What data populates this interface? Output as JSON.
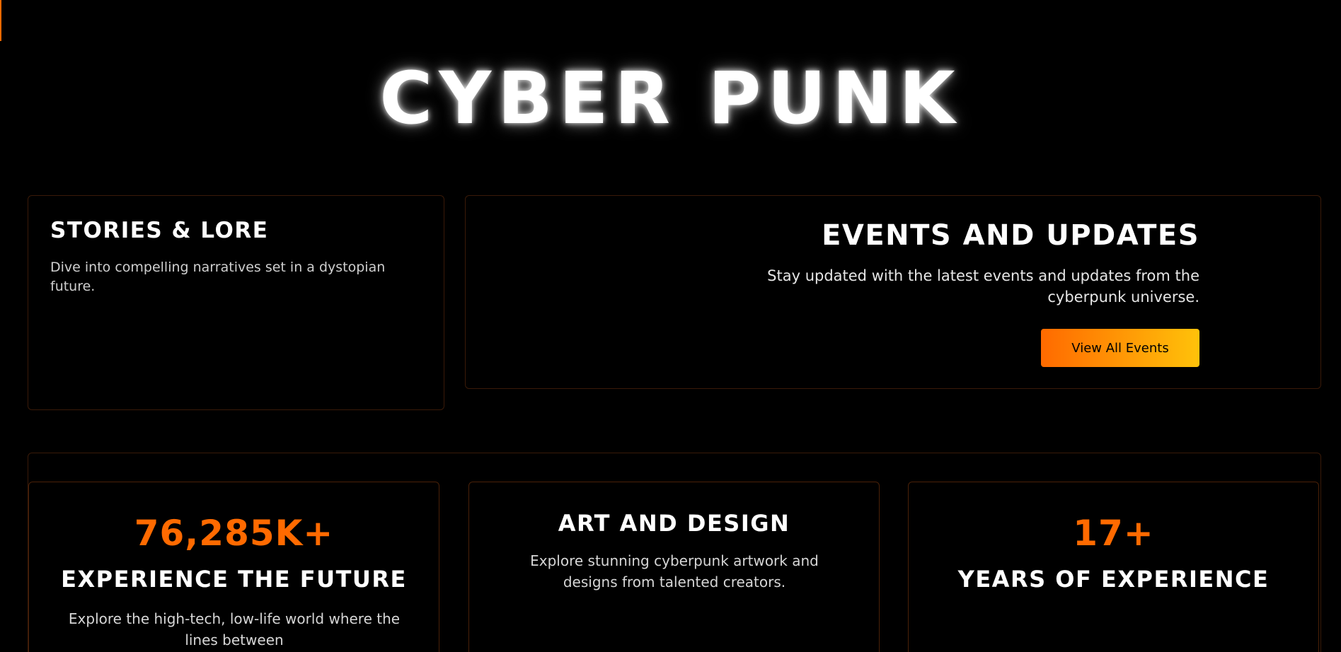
{
  "hero": {
    "title": "CYBER PUNK"
  },
  "stories": {
    "title": "STORIES & LORE",
    "description": "Dive into compelling narratives set in a dystopian future."
  },
  "events": {
    "title": "EVENTS AND UPDATES",
    "description": "Stay updated with the latest events and updates from the cyberpunk universe.",
    "button_label": "View All Events"
  },
  "stats": [
    {
      "number": "76,285K+",
      "heading": "EXPERIENCE THE FUTURE",
      "text": "Explore the high-tech, low-life world where the lines between"
    },
    {
      "heading": "ART AND DESIGN",
      "text": "Explore stunning cyberpunk artwork and designs from talented creators."
    },
    {
      "number": "17+",
      "heading": "YEARS OF EXPERIENCE"
    }
  ],
  "colors": {
    "accent": "#ff6a00",
    "accent_end": "#ffc20a",
    "background": "#000000",
    "text": "#ffffff"
  }
}
